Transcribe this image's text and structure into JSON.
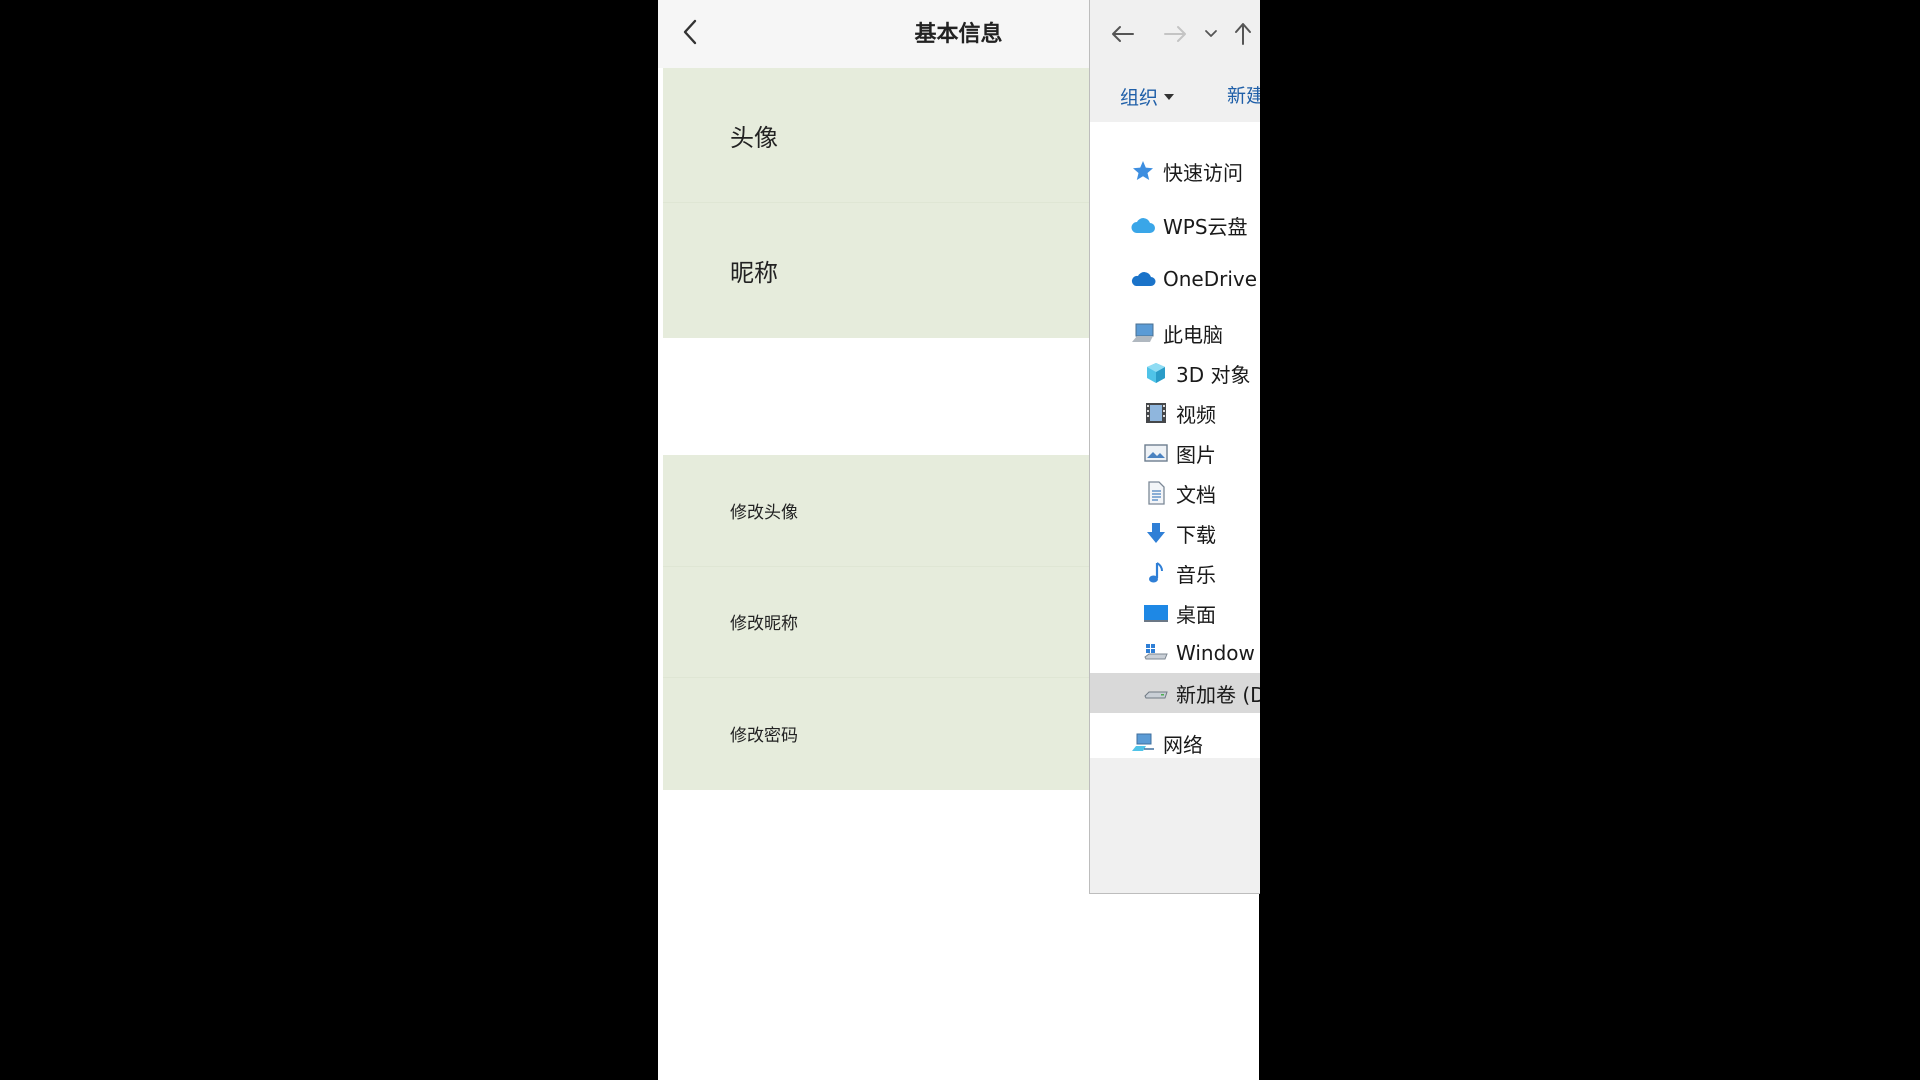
{
  "app": {
    "title": "基本信息",
    "profile_rows": [
      {
        "label": "头像"
      },
      {
        "label": "昵称"
      }
    ],
    "action_rows": [
      {
        "label": "修改头像"
      },
      {
        "label": "修改昵称"
      },
      {
        "label": "修改密码"
      }
    ]
  },
  "explorer": {
    "toolbar": {
      "organize_label": "组织",
      "new_folder_label": "新建"
    },
    "nav_items": [
      {
        "label": "快速访问",
        "icon": "star-icon"
      },
      {
        "label": "WPS云盘",
        "icon": "wps-cloud-icon"
      },
      {
        "label": "OneDrive",
        "icon": "onedrive-icon"
      },
      {
        "label": "此电脑",
        "icon": "computer-icon"
      },
      {
        "label": "3D 对象",
        "icon": "3d-objects-icon"
      },
      {
        "label": "视频",
        "icon": "video-icon"
      },
      {
        "label": "图片",
        "icon": "pictures-icon"
      },
      {
        "label": "文档",
        "icon": "documents-icon"
      },
      {
        "label": "下载",
        "icon": "download-icon"
      },
      {
        "label": "音乐",
        "icon": "music-icon"
      },
      {
        "label": "桌面",
        "icon": "desktop-icon"
      },
      {
        "label": "Window",
        "icon": "windows-drive-icon"
      },
      {
        "label": "新加卷 (D",
        "icon": "drive-icon",
        "selected": true
      },
      {
        "label": "网络",
        "icon": "network-icon"
      }
    ]
  },
  "colors": {
    "row_bg": "#e6ecdc",
    "link_blue": "#1f5fa8",
    "selected_bg": "#d9d9d9"
  }
}
